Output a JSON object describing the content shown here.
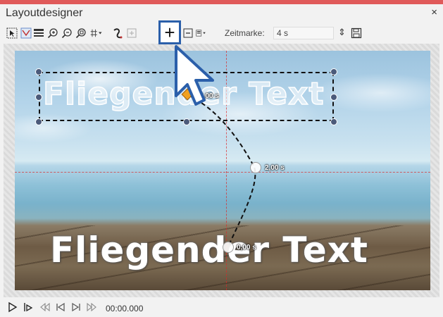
{
  "window": {
    "title": "Layoutdesigner",
    "close_label": "×"
  },
  "toolbar": {
    "zeitmarke_label": "Zeitmarke:",
    "zeitmarke_value": "4 s",
    "spinner_glyph": "⇕",
    "add_button_glyph": "+",
    "icons": [
      "select-icon",
      "select-area-icon",
      "lines-icon",
      "zoom-in-icon",
      "zoom-out-icon",
      "zoom-fit-icon",
      "grid-icon",
      "path-icon",
      "add-keyframe-icon",
      "remove-keyframe-icon",
      "align-icon",
      "save-icon"
    ]
  },
  "canvas": {
    "objects": [
      {
        "text": "Fliegender Text",
        "role": "ghost-preview"
      },
      {
        "text": "Fliegender Text",
        "role": "current"
      }
    ],
    "keyframes": [
      "3,00 s",
      "2,00 s",
      "0,00 s"
    ]
  },
  "playbar": {
    "time": "00:00.000",
    "icons": [
      "play-icon",
      "play-from-cursor-icon",
      "rewind-icon",
      "prev-frame-icon",
      "next-frame-icon",
      "forward-icon"
    ]
  },
  "colors": {
    "accent_bar": "#e05a5a",
    "highlight_border": "#2b5faa",
    "guide_line": "#dc2828",
    "handle": "#4b5a7a"
  }
}
